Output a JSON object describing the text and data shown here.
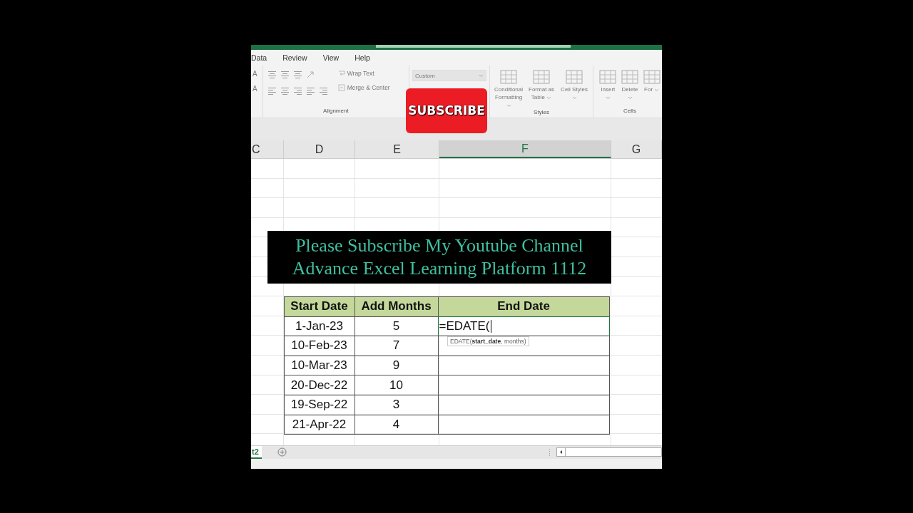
{
  "menu": [
    {
      "label": "Data"
    },
    {
      "label": "Review"
    },
    {
      "label": "View"
    },
    {
      "label": "Help"
    }
  ],
  "ribbon": {
    "font_glyphs": [
      "A",
      "A"
    ],
    "wrap_text": "Wrap Text",
    "merge_center": "Merge & Center",
    "alignment_label": "Alignment",
    "number_format": "Custom",
    "styles": [
      {
        "label": "Conditional Formatting"
      },
      {
        "label": "Format as Table"
      },
      {
        "label": "Cell Styles"
      }
    ],
    "styles_label": "Styles",
    "cells": [
      {
        "label": "Insert"
      },
      {
        "label": "Delete"
      },
      {
        "label": "For"
      }
    ],
    "cells_label": "Cells"
  },
  "subscribe_badge": "SUBSCRIBE",
  "columns": [
    {
      "label": "C",
      "selected": false
    },
    {
      "label": "D",
      "selected": false
    },
    {
      "label": "E",
      "selected": false
    },
    {
      "label": "F",
      "selected": true
    },
    {
      "label": "G",
      "selected": false
    }
  ],
  "table": {
    "columns": [
      "Start Date",
      "Add Months",
      "End Date"
    ],
    "rows": [
      {
        "start": "1-Jan-23",
        "months": "5",
        "end": "=EDATE(",
        "editing": true
      },
      {
        "start": "10-Feb-23",
        "months": "7",
        "editing": false
      },
      {
        "start": "10-Mar-23",
        "months": "9",
        "editing": false
      },
      {
        "start": "20-Dec-22",
        "months": "10",
        "editing": false
      },
      {
        "start": "19-Sep-22",
        "months": "3",
        "editing": false
      },
      {
        "start": "21-Apr-22",
        "months": "4",
        "editing": false
      }
    ]
  },
  "tooltip": "EDATE(**start_date**, months)",
  "banner": [
    "Please Subscribe My Youtube Channel",
    "Advance Excel Learning Platform 1112"
  ],
  "sheet_tab": {
    "label": "t2",
    "selected": true
  }
}
